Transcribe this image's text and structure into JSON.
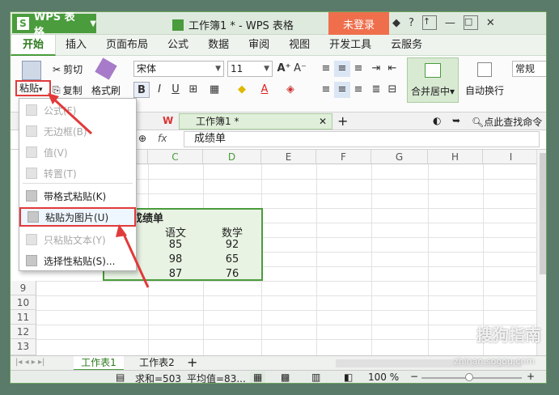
{
  "app": {
    "name": "WPS 表格",
    "logo": "S"
  },
  "title": {
    "doc": "工作簿1 * - WPS 表格",
    "login": "未登录"
  },
  "titlebar": {
    "skin": "◆",
    "help": "?"
  },
  "menu": [
    "开始",
    "插入",
    "页面布局",
    "公式",
    "数据",
    "审阅",
    "视图",
    "开发工具",
    "云服务"
  ],
  "ribbon": {
    "paste": "粘贴",
    "cut": "剪切",
    "copy": "复制",
    "format_painter": "格式刷",
    "font": "宋体",
    "size": "11",
    "merge": "合并居中",
    "wrap": "自动换行",
    "normal": "常规",
    "bold": "B",
    "italic": "I",
    "underline": "U"
  },
  "doc_tab": {
    "name": "工作簿1 *",
    "find": "点此查找命令"
  },
  "formula": {
    "fx": "fx",
    "content": "成绩单"
  },
  "columns": [
    "C",
    "D",
    "E",
    "F",
    "G",
    "H",
    "I"
  ],
  "rows": [
    "9",
    "10",
    "11",
    "12",
    "13"
  ],
  "table": {
    "title": "成绩单",
    "headers": [
      "语文",
      "数学"
    ],
    "data": [
      [
        "85",
        "92"
      ],
      [
        "98",
        "65"
      ],
      [
        "87",
        "76"
      ]
    ]
  },
  "paste_menu": [
    {
      "label": "公式(F)",
      "enabled": false
    },
    {
      "label": "无边框(B)",
      "enabled": false
    },
    {
      "label": "值(V)",
      "enabled": false
    },
    {
      "label": "转置(T)",
      "enabled": false
    },
    {
      "label": "带格式粘贴(K)",
      "enabled": true
    },
    {
      "label": "粘贴为图片(U)",
      "enabled": true
    },
    {
      "label": "只粘贴文本(Y)",
      "enabled": false
    },
    {
      "label": "选择性粘贴(S)...",
      "enabled": true
    }
  ],
  "sheets": [
    "工作表1",
    "工作表2"
  ],
  "status": {
    "sum": "求和=503",
    "avg": "平均值=83...",
    "zoom": "100 %"
  },
  "watermark": {
    "brand": "搜狗指南",
    "url": "zhinan.sogou.com"
  },
  "colors": {
    "accent": "#4a9c3c",
    "highlight": "#e23a3a",
    "login": "#ef6f4d"
  }
}
